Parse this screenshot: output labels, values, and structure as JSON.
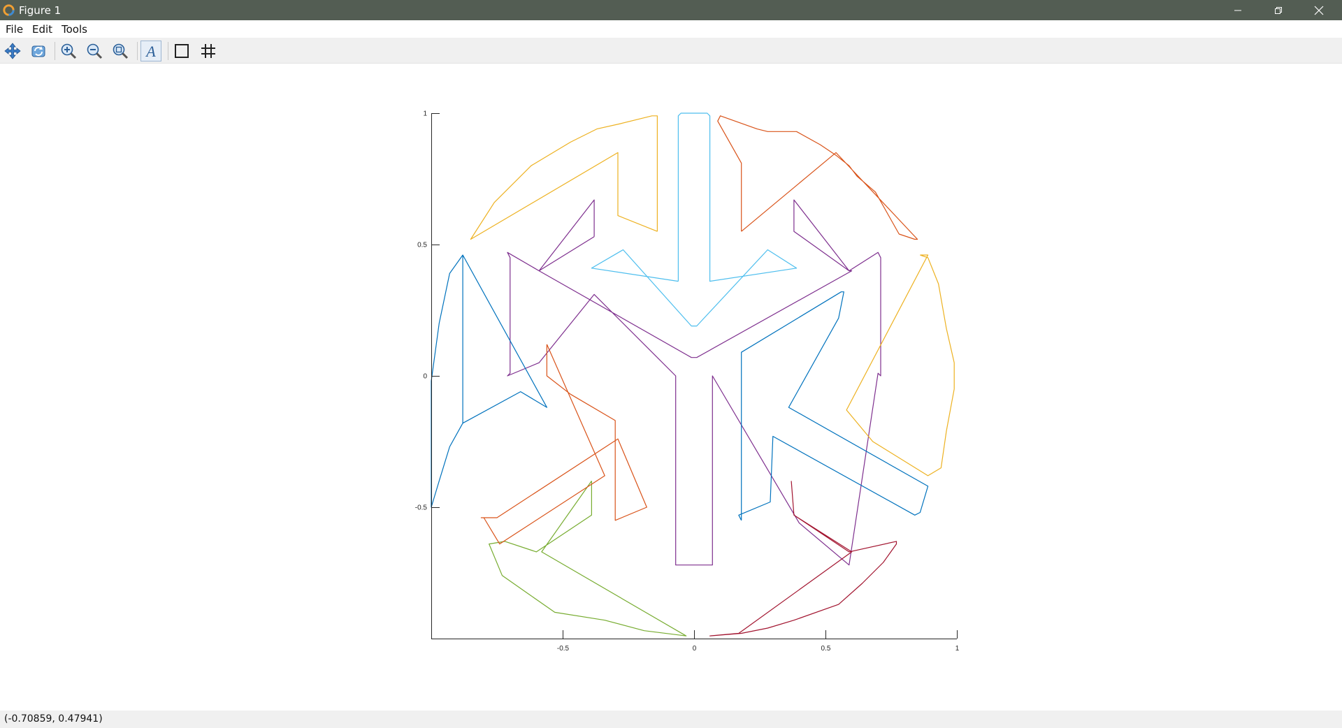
{
  "window": {
    "title": "Figure 1",
    "controls": [
      "minimize-icon",
      "maximize-icon",
      "close-icon"
    ]
  },
  "menu": {
    "file": "File",
    "edit": "Edit",
    "tools": "Tools"
  },
  "toolbar": {
    "buttons": [
      "pan-icon",
      "rotate-icon",
      "zoom-in-icon",
      "zoom-out-icon",
      "zoom-auto-icon",
      "text-insert-icon",
      "axes-box-icon",
      "grid-icon"
    ]
  },
  "status": {
    "coordinates": "(-0.70859, 0.47941)"
  },
  "chart_data": {
    "type": "line",
    "title": "",
    "xlabel": "",
    "ylabel": "",
    "xlim": [
      -1,
      1
    ],
    "ylim": [
      -1,
      1
    ],
    "grid": false,
    "legend": "none",
    "x_ticks": [
      -0.5,
      0,
      0.5,
      1
    ],
    "x_tick_labels": [
      "-0.5",
      "0",
      "0.5",
      "1"
    ],
    "y_ticks": [
      -0.5,
      0,
      0.5,
      1
    ],
    "y_tick_labels": [
      "-0.5",
      "0",
      "0.5",
      "1"
    ],
    "series": [
      {
        "color": "#4DBEEE",
        "x": [
          -0.06,
          -0.06,
          -0.05,
          0.05,
          0.06,
          0.06,
          0.39,
          0.39,
          0.28,
          0.01,
          0.0,
          -0.01,
          -0.27,
          -0.39,
          -0.39,
          -0.06
        ],
        "y": [
          0.36,
          0.99,
          1.0,
          1.0,
          0.99,
          0.36,
          0.41,
          0.41,
          0.48,
          0.19,
          0.19,
          0.19,
          0.48,
          0.41,
          0.41,
          0.36
        ]
      },
      {
        "color": "#D95319",
        "x": [
          0.18,
          0.18,
          0.09,
          0.1,
          0.24,
          0.28,
          0.39,
          0.48,
          0.54,
          0.59,
          0.62,
          0.69,
          0.78,
          0.84,
          0.85,
          0.54,
          0.54,
          0.18
        ],
        "y": [
          0.55,
          0.81,
          0.97,
          0.99,
          0.94,
          0.93,
          0.93,
          0.88,
          0.84,
          0.8,
          0.76,
          0.7,
          0.54,
          0.52,
          0.52,
          0.85,
          0.85,
          0.55
        ]
      },
      {
        "color": "#EDB120",
        "x": [
          -0.14,
          -0.14,
          -0.16,
          -0.28,
          -0.37,
          -0.47,
          -0.62,
          -0.76,
          -0.85,
          -0.85,
          -0.29,
          -0.29,
          -0.14
        ],
        "y": [
          0.55,
          0.99,
          0.99,
          0.96,
          0.94,
          0.89,
          0.8,
          0.66,
          0.52,
          0.52,
          0.85,
          0.61,
          0.55
        ]
      },
      {
        "color": "#7E2F8E",
        "x": [
          -0.38,
          -0.38,
          -0.59,
          -0.59,
          -0.71,
          -0.7,
          -0.7,
          -0.71,
          -0.59,
          -0.59,
          -0.38,
          -0.07,
          -0.07,
          -0.02,
          0.02,
          0.07,
          0.07,
          0.4,
          0.4,
          0.59,
          0.59,
          0.7,
          0.71,
          0.71,
          0.7,
          0.59,
          0.59,
          0.38,
          0.38,
          0.59,
          0.6,
          0.01,
          0.0,
          -0.01,
          -0.59,
          -0.38
        ],
        "y": [
          0.53,
          0.67,
          0.4,
          0.4,
          0.47,
          0.45,
          0.01,
          0.0,
          0.05,
          0.05,
          0.31,
          0.0,
          -0.72,
          -0.72,
          -0.72,
          -0.72,
          0.0,
          -0.56,
          -0.56,
          -0.72,
          -0.72,
          0.01,
          0.0,
          0.45,
          0.47,
          0.4,
          0.4,
          0.67,
          0.55,
          0.4,
          0.4,
          0.07,
          0.07,
          0.07,
          0.4,
          0.53
        ]
      },
      {
        "color": "#0072BD",
        "x": [
          -0.88,
          -0.88,
          -0.93,
          -0.97,
          -1.0,
          -1.0,
          -0.97,
          -0.93,
          -0.88,
          -0.56,
          -0.56,
          -0.66,
          -0.66,
          -0.88,
          -0.88
        ],
        "y": [
          0.46,
          -0.18,
          -0.27,
          -0.4,
          -0.5,
          -0.02,
          0.2,
          0.39,
          0.46,
          -0.12,
          -0.12,
          -0.06,
          -0.06,
          -0.18,
          0.46
        ]
      },
      {
        "color": "#0072BD",
        "x": [
          0.18,
          0.18,
          0.56,
          0.57,
          0.55,
          0.36,
          0.89,
          0.89,
          0.86,
          0.84,
          0.3,
          0.29,
          0.17,
          0.18
        ],
        "y": [
          -0.55,
          0.09,
          0.32,
          0.32,
          0.22,
          -0.12,
          -0.42,
          -0.42,
          -0.52,
          -0.53,
          -0.23,
          -0.48,
          -0.53,
          -0.55
        ]
      },
      {
        "color": "#77AC30",
        "x": [
          -0.39,
          -0.39,
          -0.6,
          -0.72,
          -0.78,
          -0.73,
          -0.63,
          -0.53,
          -0.34,
          -0.19,
          -0.03,
          -0.03,
          -0.58,
          -0.39
        ],
        "y": [
          -0.4,
          -0.53,
          -0.67,
          -0.63,
          -0.64,
          -0.76,
          -0.83,
          -0.9,
          -0.93,
          -0.97,
          -0.99,
          -0.99,
          -0.67,
          -0.4
        ]
      },
      {
        "color": "#D95319",
        "x": [
          -0.56,
          -0.56,
          -0.47,
          -0.3,
          -0.3,
          -0.18,
          -0.18,
          -0.29,
          -0.29,
          -0.75,
          -0.81,
          -0.8,
          -0.74,
          -0.34,
          -0.56
        ],
        "y": [
          0.12,
          0.0,
          -0.07,
          -0.17,
          -0.55,
          -0.5,
          -0.5,
          -0.24,
          -0.24,
          -0.54,
          -0.54,
          -0.54,
          -0.64,
          -0.38,
          0.12
        ]
      },
      {
        "color": "#A2142F",
        "x": [
          0.37,
          0.38,
          0.59,
          0.77,
          0.77,
          0.72,
          0.64,
          0.55,
          0.38,
          0.28,
          0.18,
          0.06,
          0.06,
          0.17,
          0.6,
          0.38,
          0.37
        ],
        "y": [
          -0.4,
          -0.53,
          -0.67,
          -0.63,
          -0.64,
          -0.71,
          -0.79,
          -0.87,
          -0.93,
          -0.96,
          -0.98,
          -0.99,
          -0.99,
          -0.98,
          -0.67,
          -0.53,
          -0.4
        ]
      },
      {
        "color": "#EDB120",
        "x": [
          0.86,
          0.89,
          0.93,
          0.96,
          0.99,
          0.99,
          0.96,
          0.94,
          0.89,
          0.89,
          0.68,
          0.68,
          0.58,
          0.58,
          0.89,
          0.89,
          0.86
        ],
        "y": [
          0.46,
          0.45,
          0.35,
          0.18,
          0.05,
          -0.05,
          -0.21,
          -0.35,
          -0.38,
          -0.38,
          -0.25,
          -0.25,
          -0.13,
          -0.13,
          0.46,
          0.46,
          0.46
        ]
      }
    ]
  }
}
